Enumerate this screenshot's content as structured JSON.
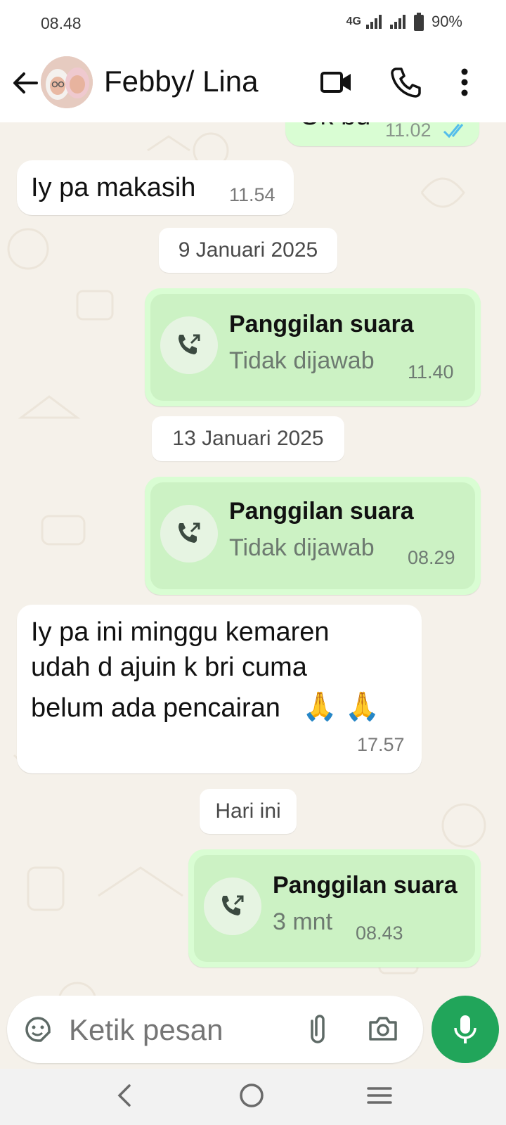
{
  "status_bar": {
    "time": "08.48",
    "network": "4G",
    "battery": "90%"
  },
  "header": {
    "contact_name": "Febby/ Lina"
  },
  "messages": {
    "partial_out_text": "Ok bu",
    "partial_out_time": "11.02",
    "msg1_text": "Iy pa makasih",
    "msg1_time": "11.54",
    "date1": "9 Januari 2025",
    "call1_title": "Panggilan suara",
    "call1_status": "Tidak dijawab",
    "call1_time": "11.40",
    "date2": "13 Januari 2025",
    "call2_title": "Panggilan suara",
    "call2_status": "Tidak dijawab",
    "call2_time": "08.29",
    "msg2_line1": "Iy pa ini minggu kemaren",
    "msg2_line2": "udah d ajuin k bri cuma",
    "msg2_line3": "belum ada pencairan",
    "msg2_emoji": "🙏 🙏",
    "msg2_time": "17.57",
    "date3": "Hari ini",
    "call3_title": "Panggilan suara",
    "call3_status": "3 mnt",
    "call3_time": "08.43"
  },
  "composer": {
    "placeholder": "Ketik pesan"
  },
  "colors": {
    "outgoing": "#d9fdd3",
    "accent": "#21a55a",
    "read_tick": "#53bdeb"
  },
  "icons": [
    "back-arrow-icon",
    "video-call-icon",
    "voice-call-icon",
    "more-options-icon",
    "sticker-icon",
    "attach-icon",
    "camera-icon",
    "mic-icon",
    "outgoing-call-icon",
    "double-check-icon"
  ]
}
